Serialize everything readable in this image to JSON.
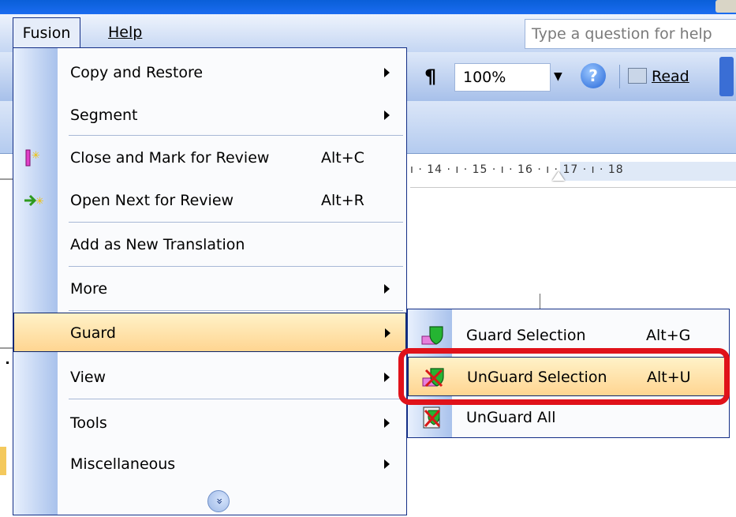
{
  "menubar": {
    "menus": [
      {
        "label": "Fusion",
        "active": true
      },
      {
        "label": "Help",
        "active": false
      }
    ],
    "ask_placeholder": "Type a question for help"
  },
  "toolbar": {
    "pilcrow": "¶",
    "zoom_value": "100%",
    "help_glyph": "?",
    "read_label": "Read"
  },
  "ruler": {
    "ticks": "ı · 14 · ı · 15 · ı · 16 · ı · 17 · ı · 18"
  },
  "fusion_menu": {
    "items": [
      {
        "label": "Copy and Restore",
        "shortcut": "",
        "submenu": true,
        "icon": ""
      },
      {
        "label": "Segment",
        "shortcut": "",
        "submenu": true,
        "icon": ""
      },
      {
        "label": "Close and Mark for Review",
        "shortcut": "Alt+C",
        "submenu": false,
        "icon": "close-mark-review-icon"
      },
      {
        "label": "Open Next for Review",
        "shortcut": "Alt+R",
        "submenu": false,
        "icon": "open-next-review-icon"
      },
      {
        "label": "Add as New Translation",
        "shortcut": "",
        "submenu": false,
        "icon": ""
      },
      {
        "label": "More",
        "shortcut": "",
        "submenu": true,
        "icon": ""
      },
      {
        "label": "Guard",
        "shortcut": "",
        "submenu": true,
        "icon": "",
        "highlighted": true
      },
      {
        "label": "View",
        "shortcut": "",
        "submenu": true,
        "icon": ""
      },
      {
        "label": "Tools",
        "shortcut": "",
        "submenu": true,
        "icon": ""
      },
      {
        "label": "Miscellaneous",
        "shortcut": "",
        "submenu": true,
        "icon": ""
      }
    ],
    "expand_glyph": "»"
  },
  "guard_submenu": {
    "items": [
      {
        "label": "Guard Selection",
        "shortcut": "Alt+G",
        "icon": "guard-selection-icon"
      },
      {
        "label": "UnGuard Selection",
        "shortcut": "Alt+U",
        "icon": "unguard-selection-icon",
        "highlighted": true
      },
      {
        "label": "UnGuard All",
        "shortcut": "",
        "icon": "unguard-all-icon"
      }
    ]
  },
  "colors": {
    "highlight": "#ffd591",
    "annotation_ring": "#e0121a",
    "menu_border": "#132e86"
  }
}
